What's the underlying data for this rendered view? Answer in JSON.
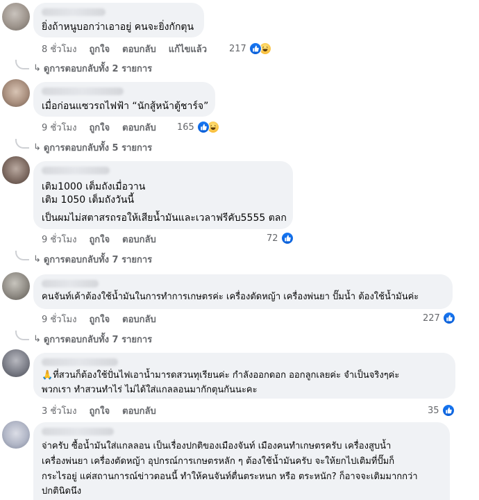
{
  "labels": {
    "like": "ถูกใจ",
    "reply": "ตอบกลับ",
    "edited": "แก้ไขแล้ว"
  },
  "comments": [
    {
      "text": "ยิ่งถ้าหนูบอกว่าเอาอยู่ คนจะยิ่งกักตุน",
      "time": "8 ชั่วโมง",
      "reactions": "217",
      "reaction_icons": [
        "like-icon",
        "haha-icon"
      ],
      "replies": "ดูการตอบกลับทั้ง 2 รายการ"
    },
    {
      "text": "เมื่อก่อนแซวรถไฟฟ้า “นักสู้หน้าตู้ชาร์จ”",
      "time": "9 ชั่วโมง",
      "reactions": "165",
      "reaction_icons": [
        "like-icon",
        "haha-icon"
      ],
      "replies": "ดูการตอบกลับทั้ง 5 รายการ"
    },
    {
      "text_line1": "เติม1000 เต็มถังเมื่อวาน",
      "text_line2": "เติม 1050 เต็มถังวันนี้",
      "text_line3": "เป็นผมไม่สตาสรถรอให้เสียน้ำมันและเวลาฟรีคับ5555 ตลก",
      "time": "9 ชั่วโมง",
      "reactions": "72",
      "reaction_icons": [
        "like-icon"
      ],
      "replies": "ดูการตอบกลับทั้ง 7 รายการ"
    },
    {
      "text": "คนจันท์เค้าต้องใช้น้ำมันในการทำการเกษตรค่ะ เครื่องตัดหญ้า เครื่องพ่นยา ปั๊มน้ำ ต้องใช้น้ำมันค่ะ",
      "time": "9 ชั่วโมง",
      "reactions": "227",
      "reaction_icons": [
        "like-icon"
      ],
      "replies": "ดูการตอบกลับทั้ง 7 รายการ"
    },
    {
      "emoji": "🙏",
      "text_line1": "ที่สวนก็ต้องใช้ปั่นไฟเอาน้ำมารดสวนทุเรียนค่ะ กำลังออกดอก ออกลูกเลยค่ะ จำเป็นจริงๆค่ะ",
      "text_line2": "พวกเรา ทำสวนทำไร่ ไม่ได้ใส่แกลลอนมากักตุนกันนะคะ",
      "time": "3 ชั่วโมง",
      "reactions": "35",
      "reaction_icons": [
        "like-icon"
      ]
    },
    {
      "text_line1": "จ่าครับ ซื้อน้ำมันใส่แกลลอน เป็นเรื่องปกติของเมืองจันท์ เมืองคนทำเกษตรครับ เครื่องสูบน้ำ",
      "text_line2": "เครื่องพ่นยา เครื่องตัดหญ้า อุปกรณ์การเกษตรหลัก ๆ ต้องใช้น้ำมันครับ จะให้ยกไปเติมที่ปั๊มก็",
      "text_line3": "กระไรอยู่ แค่สถานการณ์ข่าวตอนนี้ ทำให้คนจันท์ตื่นตระหนก หรือ ตระหนัก? ก็อาจจะเติมมากกว่า",
      "text_line4": "ปกตินิดนึง"
    }
  ]
}
